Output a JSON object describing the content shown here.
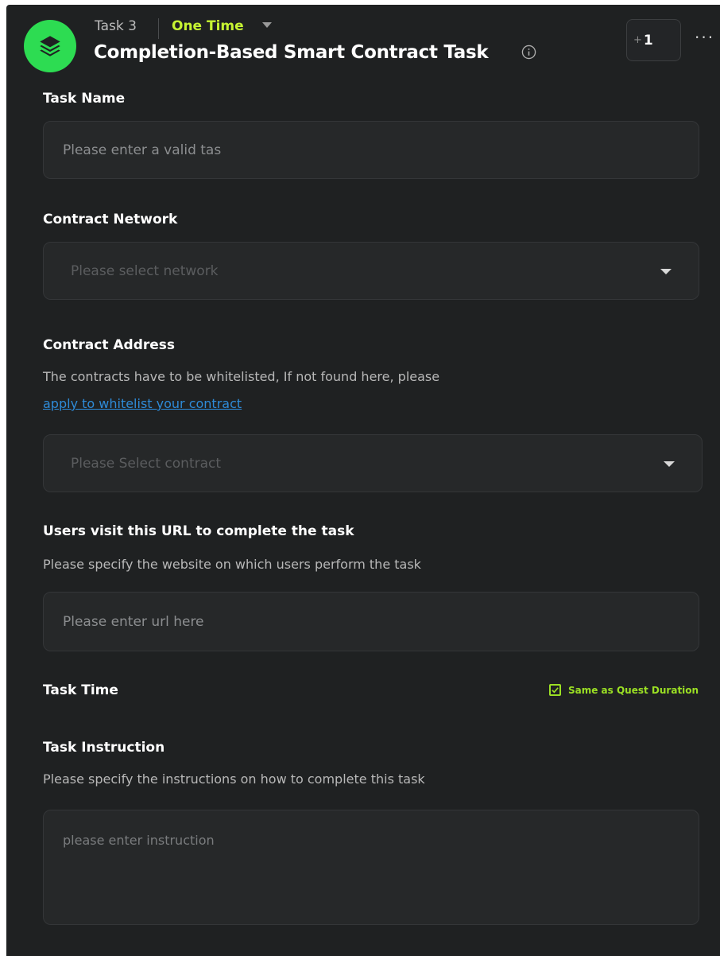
{
  "header": {
    "task_number": "Task 3",
    "frequency": "One Time",
    "title": "Completion-Based Smart Contract Task",
    "plus_prefix": "+",
    "plus_value": "1",
    "more": "···"
  },
  "task_name": {
    "label": "Task Name",
    "placeholder": "Please enter a valid tas"
  },
  "contract_network": {
    "label": "Contract Network",
    "placeholder": "Please select network"
  },
  "contract_address": {
    "label": "Contract Address",
    "description": "The contracts have to be whitelisted, If not found here, please",
    "link": "apply to whitelist your contract",
    "placeholder": "Please Select contract"
  },
  "url": {
    "label": "Users visit this URL to complete the task",
    "description": "Please specify the website on which users perform the task",
    "placeholder": "Please enter url here"
  },
  "task_time": {
    "label": "Task Time",
    "checkbox_label": "Same as Quest Duration",
    "checked": true
  },
  "instruction": {
    "label": "Task Instruction",
    "description": "Please specify the instructions on how to complete this task",
    "placeholder": "please enter instruction"
  },
  "colors": {
    "panel": "#1f2122",
    "accent_green": "#2ddc52",
    "frequency_lime": "#c6f432",
    "link_blue": "#2e8bd8"
  }
}
